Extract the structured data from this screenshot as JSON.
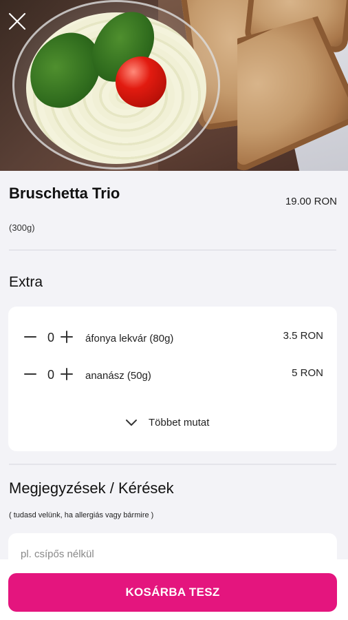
{
  "product": {
    "name": "Bruschetta Trio",
    "price": "19.00 RON",
    "weight": "(300g)"
  },
  "extras": {
    "title": "Extra",
    "items": [
      {
        "quantity": "0",
        "name": "áfonya lekvár (80g)",
        "price": "3.5 RON"
      },
      {
        "quantity": "0",
        "name": "ananász (50g)",
        "price": "5 RON"
      }
    ],
    "show_more_label": "Többet mutat"
  },
  "notes": {
    "title": "Megjegyzések / Kérések",
    "hint": "( tudasd velünk, ha allergiás vagy bármire )",
    "placeholder": "pl. csípős nélkül"
  },
  "actions": {
    "add_to_cart_label": "KOSÁRBA TESZ"
  },
  "colors": {
    "accent": "#e4157e",
    "background": "#f3f3f7",
    "card": "#ffffff"
  },
  "icons": {
    "close": "close-icon",
    "minus": "minus-icon",
    "plus": "plus-icon",
    "show_more": "chevron-down-icon"
  }
}
